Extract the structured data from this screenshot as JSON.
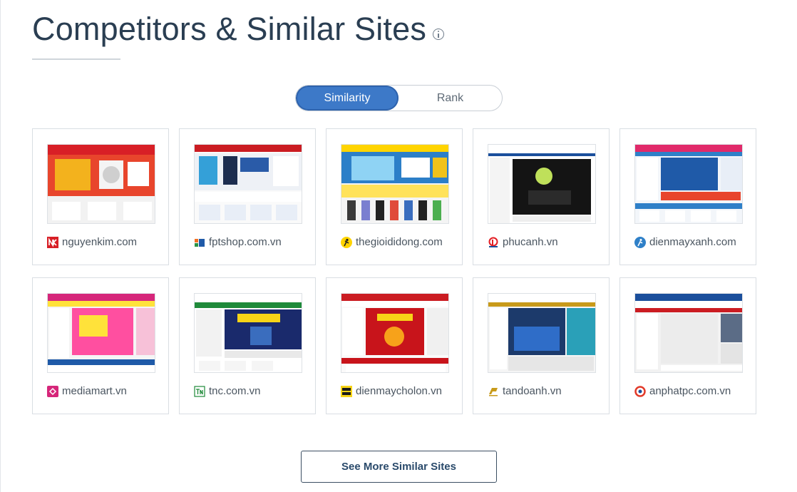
{
  "header": {
    "title": "Competitors & Similar Sites",
    "info_icon": "info-icon"
  },
  "toggle": {
    "options": [
      "Similarity",
      "Rank"
    ],
    "selected": "Similarity",
    "accent_color": "#3d79c8"
  },
  "sites": [
    {
      "name": "nguyenkim.com",
      "icon": "nguyenkim-favicon",
      "brand_color": "#d81f26"
    },
    {
      "name": "fptshop.com.vn",
      "icon": "fptshop-favicon",
      "brand_color": "#f37021"
    },
    {
      "name": "thegioididong.com",
      "icon": "thegioididong-favicon",
      "brand_color": "#ffd400"
    },
    {
      "name": "phucanh.vn",
      "icon": "phucanh-favicon",
      "brand_color": "#e31e24"
    },
    {
      "name": "dienmayxanh.com",
      "icon": "dienmayxanh-favicon",
      "brand_color": "#2f80c8"
    },
    {
      "name": "mediamart.vn",
      "icon": "mediamart-favicon",
      "brand_color": "#d6267a"
    },
    {
      "name": "tnc.com.vn",
      "icon": "tnc-favicon",
      "brand_color": "#1f8a3a"
    },
    {
      "name": "dienmaycholon.vn",
      "icon": "dienmaycholon-favicon",
      "brand_color": "#f7d417"
    },
    {
      "name": "tandoanh.vn",
      "icon": "tandoanh-favicon",
      "brand_color": "#c89a1a"
    },
    {
      "name": "anphatpc.com.vn",
      "icon": "anphatpc-favicon",
      "brand_color": "#e23a2a"
    }
  ],
  "footer": {
    "more_button_label": "See More Similar Sites"
  }
}
